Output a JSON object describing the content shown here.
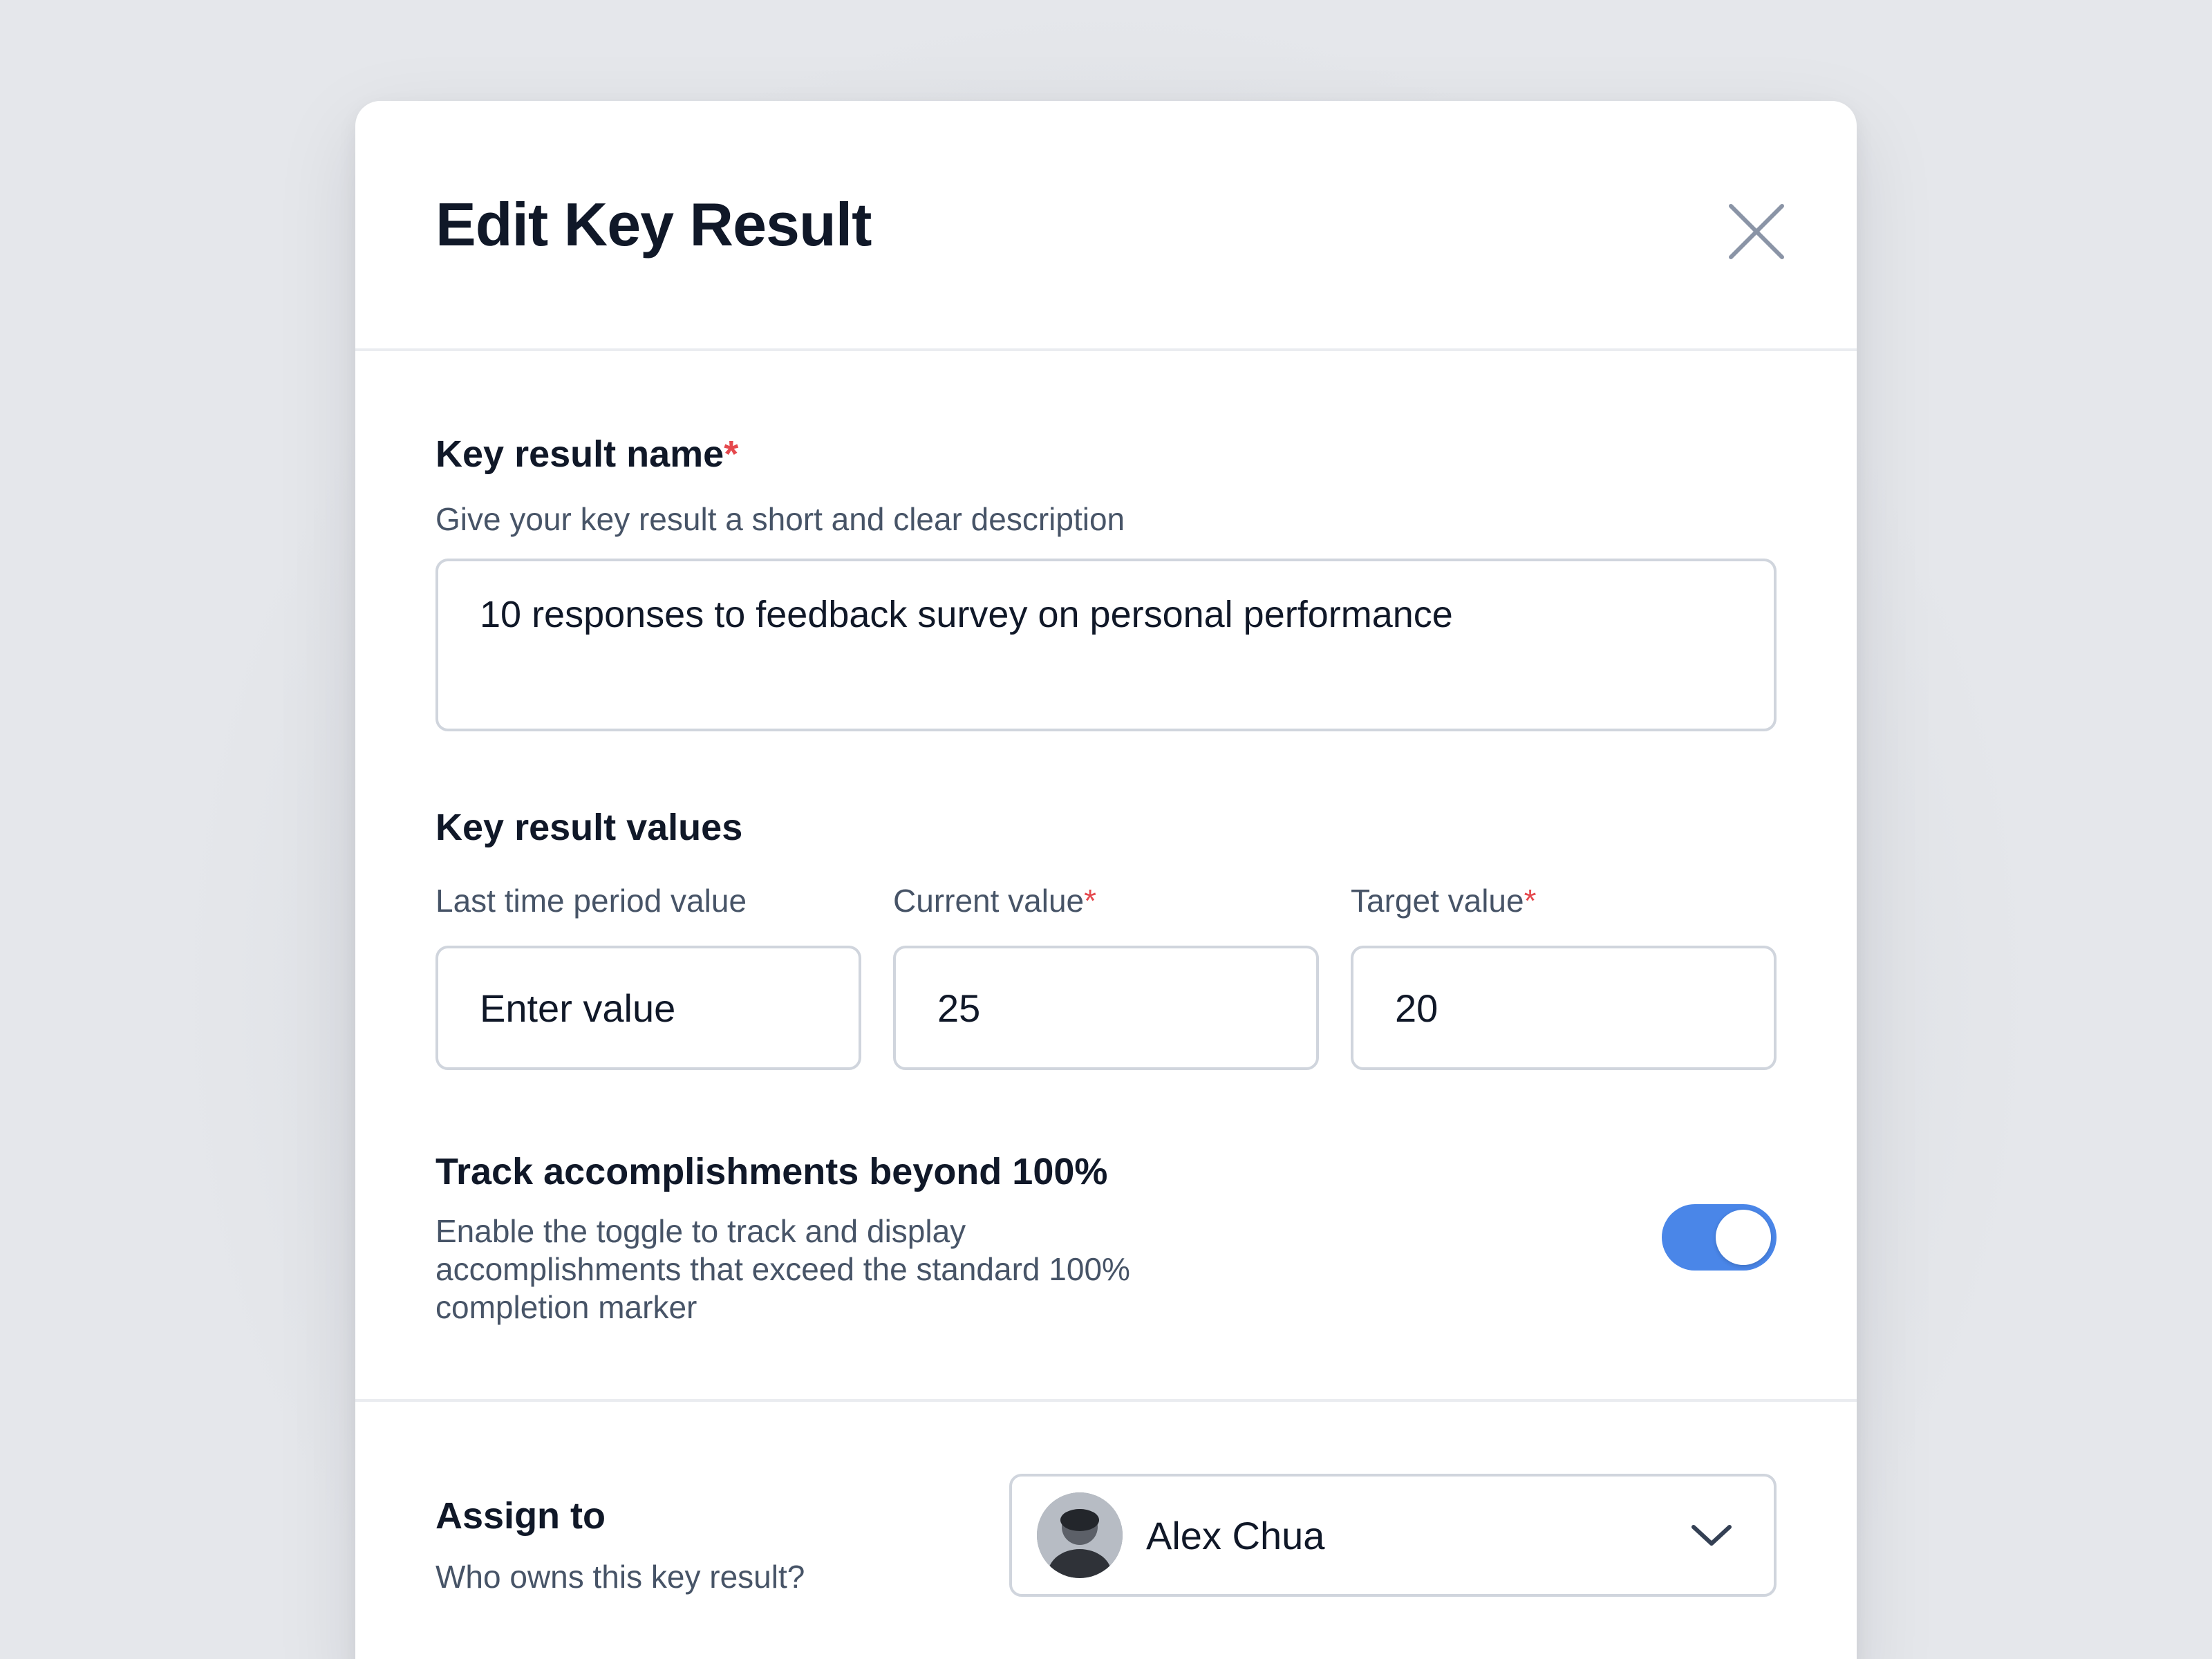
{
  "modal": {
    "title": "Edit Key Result"
  },
  "name_section": {
    "label": "Key result name",
    "required_mark": "*",
    "description": "Give your key result a short and clear description",
    "value": "10 responses to feedback survey on personal performance"
  },
  "values_section": {
    "label": "Key result values",
    "fields": [
      {
        "label": "Last time period value",
        "required": false,
        "value": "",
        "placeholder": "Enter value"
      },
      {
        "label": "Current value",
        "required": true,
        "value": "25",
        "placeholder": ""
      },
      {
        "label": "Target value",
        "required": true,
        "value": "20",
        "placeholder": ""
      }
    ],
    "required_mark": "*"
  },
  "track_section": {
    "label": "Track accomplishments beyond 100%",
    "description_lines": [
      "Enable the toggle to track and display",
      "accomplishments that exceed the standard 100%",
      "completion marker"
    ],
    "toggle_on": true
  },
  "assign_section": {
    "label": "Assign to",
    "description": "Who owns this key result?",
    "selected_user": "Alex Chua"
  },
  "colors": {
    "accent": "#4a86e8",
    "required": "#e5484d",
    "text": "#101828",
    "muted": "#475467",
    "border": "#d0d5dd"
  },
  "icons": {
    "close": "close-icon",
    "dropdown": "chevron-down-icon"
  }
}
